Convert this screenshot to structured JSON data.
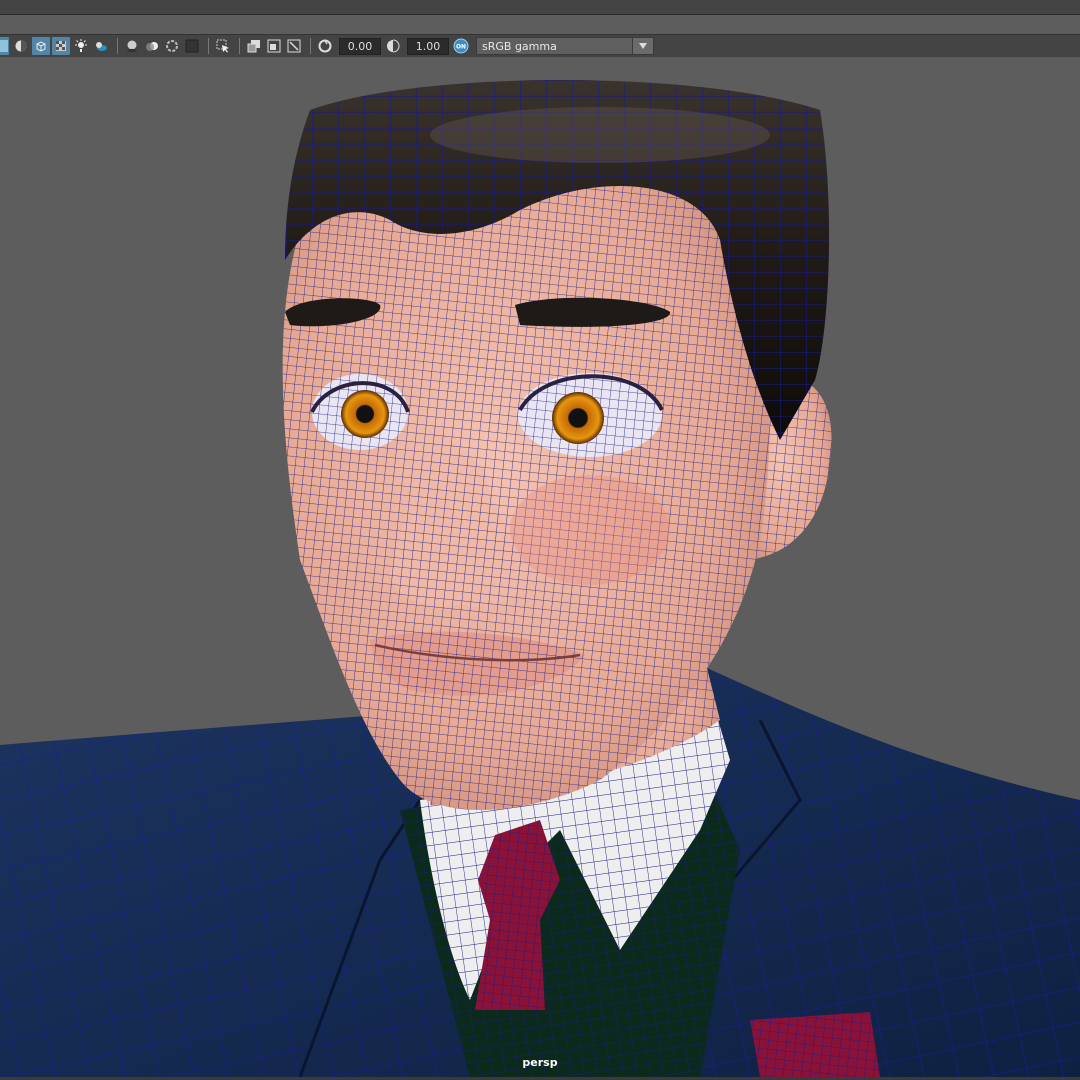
{
  "toolbar": {
    "exposure_value": "0.00",
    "gamma_value": "1.00",
    "color_management_badge": "ON",
    "color_space": "sRGB gamma"
  },
  "viewport": {
    "camera_label": "persp"
  },
  "colors": {
    "viewport_bg": "#5d5d5d",
    "toolbar_bg": "#444444",
    "toggle_active": "#5285a6",
    "wireframe": "#1a1a8c",
    "skin": "#e6a792",
    "hair": "#1f1a16",
    "suit": "#142a50",
    "vest": "#0c2a1c",
    "shirt": "#eeeeee",
    "tie": "#8a1236"
  },
  "icons": [
    "camera-tools-icon",
    "isolate-icon",
    "wireframe-on-shaded-icon",
    "xray-icon",
    "lights-icon",
    "shadows-icon",
    "ambient-occlusion-icon",
    "motion-blur-icon",
    "anti-alias-icon",
    "depth-of-field-icon",
    "resolution-gate-icon",
    "grid-icon",
    "select-icon",
    "frame-all-icon",
    "frame-selection-icon",
    "field-chart-icon",
    "exposure-icon",
    "gamma-icon",
    "color-management-icon",
    "dropdown-arrow-icon"
  ]
}
